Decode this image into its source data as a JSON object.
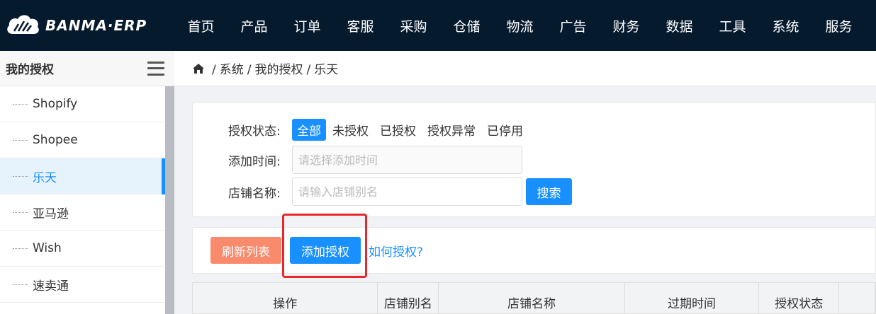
{
  "brand": {
    "logo_text": "BANMA·ERP"
  },
  "topnav": {
    "items": [
      "首页",
      "产品",
      "订单",
      "客服",
      "采购",
      "仓储",
      "物流",
      "广告",
      "财务",
      "数据",
      "工具",
      "系统",
      "服务"
    ]
  },
  "sidebar": {
    "title": "我的授权",
    "items": [
      {
        "label": "Shopify"
      },
      {
        "label": "Shopee"
      },
      {
        "label": "乐天"
      },
      {
        "label": "亚马逊"
      },
      {
        "label": "Wish"
      },
      {
        "label": "速卖通"
      }
    ],
    "active_index": 2
  },
  "breadcrumb": {
    "items": [
      "系统",
      "我的授权",
      "乐天"
    ],
    "separator": "/"
  },
  "filters": {
    "status_label": "授权状态:",
    "status_options": [
      "全部",
      "未授权",
      "已授权",
      "授权异常",
      "已停用"
    ],
    "status_selected": "全部",
    "time_label": "添加时间:",
    "time_placeholder": "请选择添加时间",
    "shop_label": "店铺名称:",
    "shop_placeholder": "请输入店铺别名",
    "search_label": "搜索"
  },
  "actions": {
    "refresh_label": "刷新列表",
    "add_label": "添加授权",
    "help_link": "如何授权?"
  },
  "table": {
    "headers": [
      "操作",
      "店铺别名",
      "店铺名称",
      "过期时间",
      "授权状态",
      ""
    ]
  },
  "colors": {
    "nav_bg": "#061a2e",
    "primary": "#1890ff",
    "refresh": "#f98a6c",
    "highlight": "#e8262b"
  }
}
